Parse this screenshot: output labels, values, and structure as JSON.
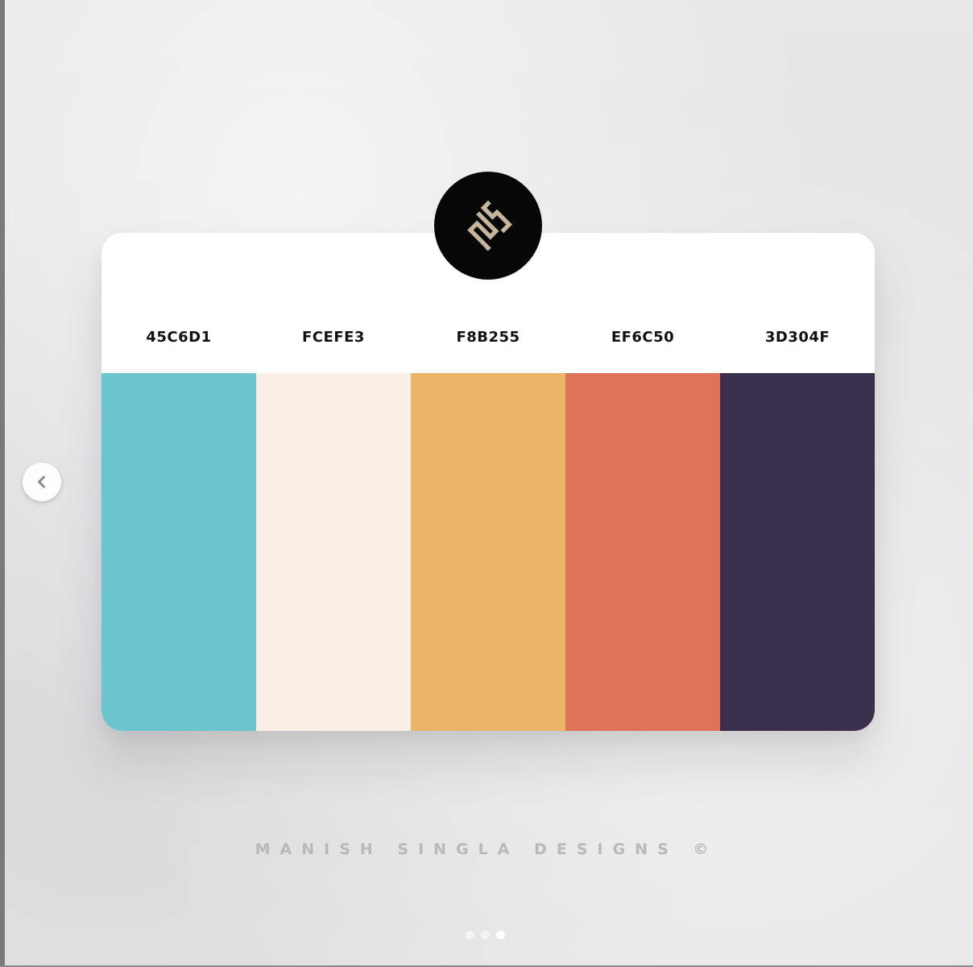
{
  "palette": {
    "swatches": [
      {
        "label": "45C6D1",
        "color": "#6BC4CE"
      },
      {
        "label": "FCEFE3",
        "color": "#F9EFE6"
      },
      {
        "label": "F8B255",
        "color": "#ECB466"
      },
      {
        "label": "EF6C50",
        "color": "#DF735A"
      },
      {
        "label": "3D304F",
        "color": "#3B304C"
      }
    ]
  },
  "logo": {
    "icon": "ms-monogram-icon",
    "background": "#070707",
    "accent": "#C5B59A"
  },
  "watermark": {
    "text": "MANISH SINGLA DESIGNS ©"
  },
  "carousel": {
    "prev_icon": "chevron-left-icon",
    "dots": [
      {
        "active": false
      },
      {
        "active": false
      },
      {
        "active": true
      }
    ]
  }
}
